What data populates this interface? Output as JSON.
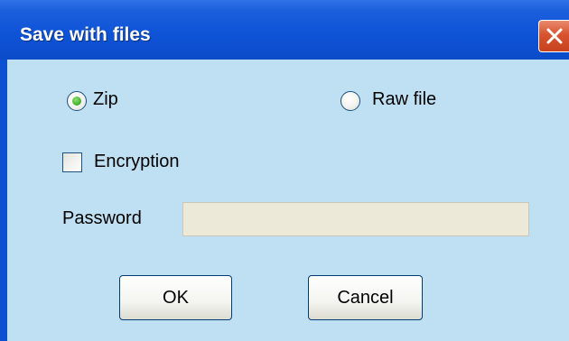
{
  "window": {
    "title": "Save with files"
  },
  "format_options": {
    "zip": {
      "label": "Zip",
      "selected": true
    },
    "raw_file": {
      "label": "Raw file",
      "selected": false
    }
  },
  "encryption": {
    "label": "Encryption",
    "checked": false
  },
  "password": {
    "label": "Password",
    "value": "",
    "enabled": false
  },
  "buttons": {
    "ok": "OK",
    "cancel": "Cancel"
  },
  "icons": {
    "close": "close-icon"
  },
  "colors": {
    "title_bar": "#0f54d8",
    "dialog_background": "#bfe0f2",
    "close_button": "#d8542f",
    "radio_selected": "#3fae2a",
    "disabled_field": "#ece9d8"
  }
}
